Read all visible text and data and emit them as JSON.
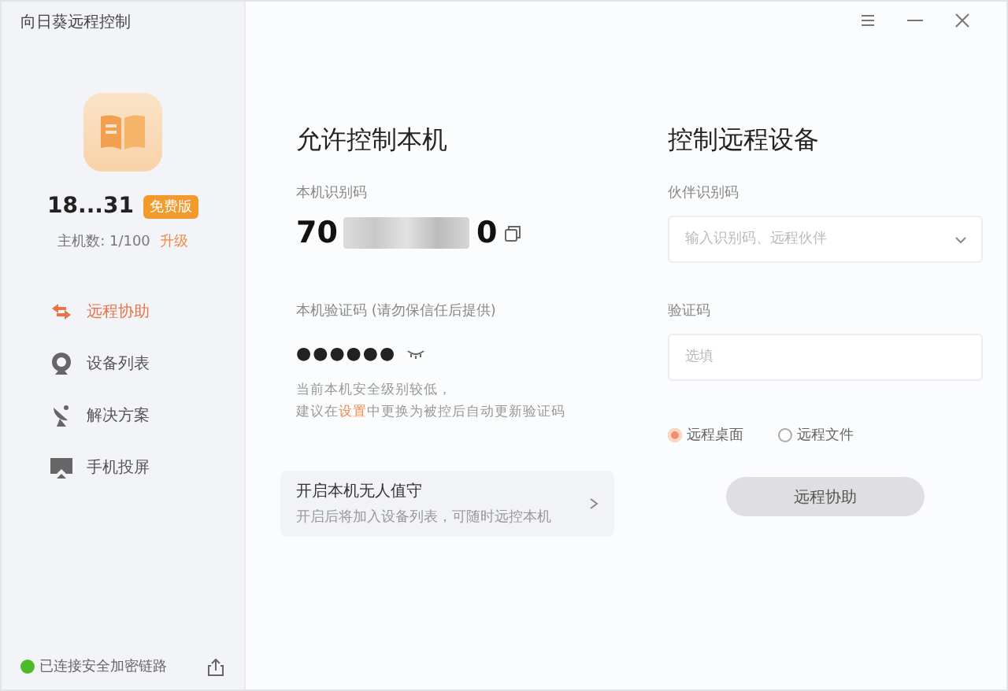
{
  "window": {
    "title": "向日葵远程控制"
  },
  "account": {
    "name": "18...31",
    "badge": "免费版",
    "hosts_label": "主机数: 1/100",
    "upgrade_link": "升级"
  },
  "sidebar": {
    "items": [
      {
        "label": "远程协助",
        "kind": "assist",
        "selected": true
      },
      {
        "label": "设备列表",
        "kind": "devices",
        "selected": false
      },
      {
        "label": "解决方案",
        "kind": "solutions",
        "selected": false
      },
      {
        "label": "手机投屏",
        "kind": "cast",
        "selected": false
      }
    ]
  },
  "status_bar": {
    "text": "已连接安全加密链路",
    "connected": true
  },
  "allow": {
    "title": "允许控制本机",
    "id_label": "本机识别码",
    "id_start": "70",
    "id_end": "0",
    "code_label": "本机验证码 (请勿保信任后提供)",
    "code_value": "●●●●●●",
    "note_line1": "当前本机安全级别较低，",
    "note_before": "建议在",
    "note_link": "设置",
    "note_after": "中更换为被控后自动更新验证码",
    "unattended": {
      "title": "开启本机无人值守",
      "subtitle": "开启后将加入设备列表，可随时远控本机"
    }
  },
  "control": {
    "title": "控制远程设备",
    "partner_label": "伙伴识别码",
    "partner_placeholder": "输入识别码、远程伙伴",
    "code_label": "验证码",
    "code_placeholder": "选填",
    "modes": [
      {
        "label": "远程桌面",
        "selected": true
      },
      {
        "label": "远程文件",
        "selected": false
      }
    ],
    "button": "远程协助"
  }
}
